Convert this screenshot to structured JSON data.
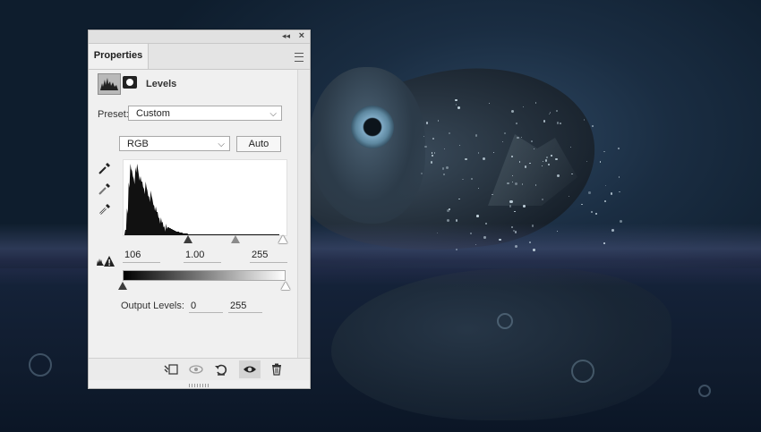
{
  "panel": {
    "tab_label": "Properties",
    "adjustment_title": "Levels",
    "preset_label": "Preset:",
    "preset_value": "Custom",
    "channel_value": "RGB",
    "auto_label": "Auto",
    "input_levels": {
      "black": "106",
      "gamma": "1.00",
      "white": "255"
    },
    "output_label": "Output Levels:",
    "output_levels": {
      "black": "0",
      "white": "255"
    }
  },
  "icons": {
    "collapse": "double-chevron-icon",
    "close": "close-icon",
    "menu": "panel-menu-icon",
    "eyedroppers": [
      "black-point-eyedropper-icon",
      "gray-point-eyedropper-icon",
      "white-point-eyedropper-icon"
    ]
  },
  "colors": {
    "panel_bg": "#f0f0f0",
    "histogram_fill": "#111111"
  }
}
